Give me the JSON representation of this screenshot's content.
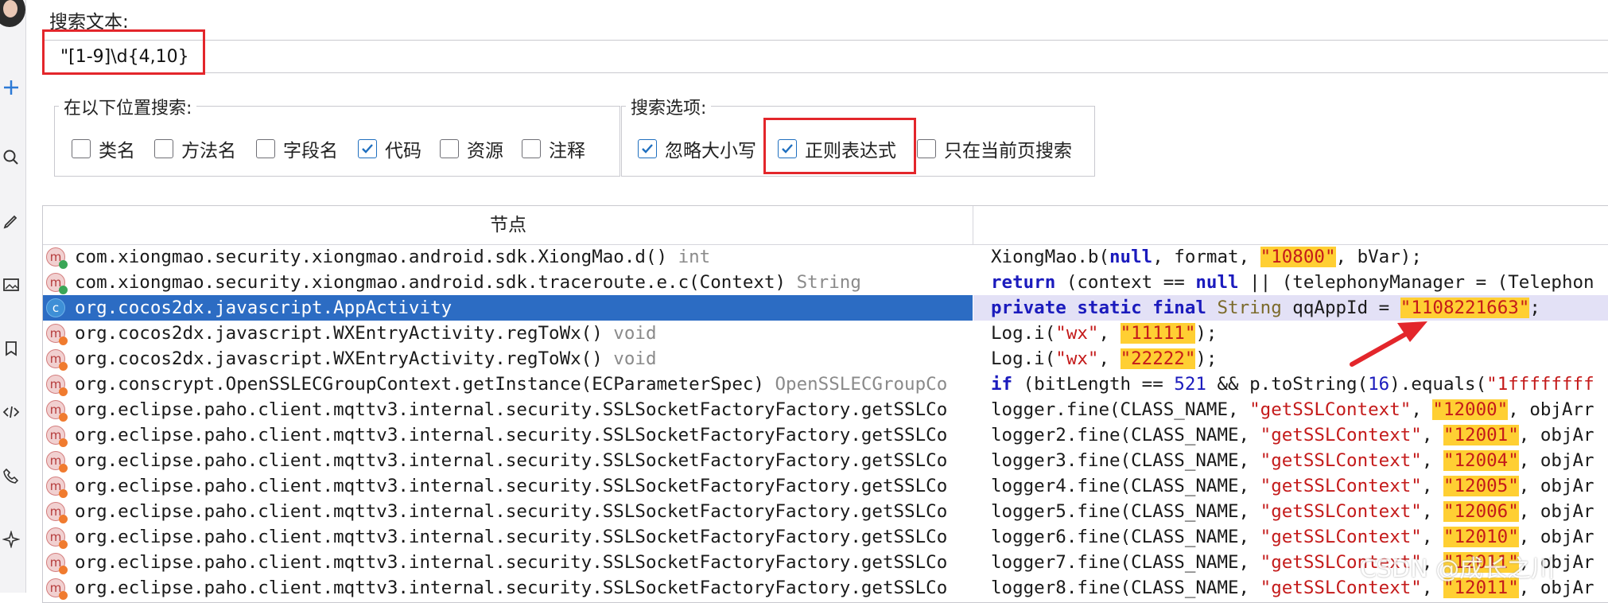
{
  "sidebar": {
    "icons": [
      "avatar",
      "plus-icon",
      "search-icon",
      "edit-icon",
      "image-icon",
      "bookmark-icon",
      "code-icon",
      "phone-icon",
      "sparkle-icon"
    ]
  },
  "search": {
    "label": "搜索文本:",
    "value": "\"[1-9]\\d{4,10}"
  },
  "location_group": {
    "title": "在以下位置搜索:",
    "options": [
      {
        "label": "类名",
        "checked": false
      },
      {
        "label": "方法名",
        "checked": false
      },
      {
        "label": "字段名",
        "checked": false
      },
      {
        "label": "代码",
        "checked": true
      },
      {
        "label": "资源",
        "checked": false
      },
      {
        "label": "注释",
        "checked": false
      }
    ]
  },
  "options_group": {
    "title": "搜索选项:",
    "options": [
      {
        "label": "忽略大小写",
        "checked": true
      },
      {
        "label": "正则表达式",
        "checked": true
      },
      {
        "label": "只在当前页搜索",
        "checked": false
      }
    ]
  },
  "results": {
    "header_node": "节点",
    "rows": [
      {
        "icon": "m",
        "node": "com.xiongmao.security.xiongmao.android.sdk.XiongMao.d()",
        "type": "int",
        "code": [
          [
            "XiongMao.b(",
            ""
          ],
          [
            "null",
            "kw"
          ],
          [
            ", format, ",
            ""
          ],
          [
            "\"10800\"",
            "hlstr"
          ],
          [
            ", bVar);",
            ""
          ]
        ]
      },
      {
        "icon": "m",
        "node": "com.xiongmao.security.xiongmao.android.sdk.traceroute.e.c(Context)",
        "type": "String",
        "code": [
          [
            "return",
            "kw"
          ],
          [
            " (context == ",
            ""
          ],
          [
            "null",
            "kw"
          ],
          [
            " || (telephonyManager = (Telephon",
            ""
          ]
        ]
      },
      {
        "icon": "c",
        "node": "org.cocos2dx.javascript.AppActivity",
        "type": "",
        "selected": true,
        "code": [
          [
            "private static final",
            "kw"
          ],
          [
            " ",
            ""
          ],
          [
            "String",
            "ty"
          ],
          [
            " qqAppId = ",
            ""
          ],
          [
            "\"1108221663\"",
            "hlstr"
          ],
          [
            ";",
            ""
          ]
        ]
      },
      {
        "icon": "m",
        "node": "org.cocos2dx.javascript.WXEntryActivity.regToWx()",
        "type": "void",
        "code": [
          [
            "Log.i(",
            ""
          ],
          [
            "\"wx\"",
            "str"
          ],
          [
            ", ",
            ""
          ],
          [
            "\"11111\"",
            "hlstr"
          ],
          [
            ");",
            ""
          ]
        ]
      },
      {
        "icon": "m",
        "node": "org.cocos2dx.javascript.WXEntryActivity.regToWx()",
        "type": "void",
        "code": [
          [
            "Log.i(",
            ""
          ],
          [
            "\"wx\"",
            "str"
          ],
          [
            ", ",
            ""
          ],
          [
            "\"22222\"",
            "hlstr"
          ],
          [
            ");",
            ""
          ]
        ]
      },
      {
        "icon": "m",
        "node": "org.conscrypt.OpenSSLECGroupContext.getInstance(ECParameterSpec)",
        "type": "OpenSSLECGroupCo",
        "code": [
          [
            "if",
            "kw"
          ],
          [
            " (bitLength == ",
            ""
          ],
          [
            "521",
            "num"
          ],
          [
            " && p.toString(",
            ""
          ],
          [
            "16",
            "num"
          ],
          [
            ").equals(",
            ""
          ],
          [
            "\"1ffffffff",
            "str"
          ]
        ]
      },
      {
        "icon": "m",
        "node": "org.eclipse.paho.client.mqttv3.internal.security.SSLSocketFactoryFactory.getSSLCo",
        "type": "",
        "code": [
          [
            "logger.fine(CLASS_NAME, ",
            ""
          ],
          [
            "\"getSSLContext\"",
            "str"
          ],
          [
            ", ",
            ""
          ],
          [
            "\"12000\"",
            "hlstr"
          ],
          [
            ", objArr",
            ""
          ]
        ]
      },
      {
        "icon": "m",
        "node": "org.eclipse.paho.client.mqttv3.internal.security.SSLSocketFactoryFactory.getSSLCo",
        "type": "",
        "code": [
          [
            "logger2.fine(CLASS_NAME, ",
            ""
          ],
          [
            "\"getSSLContext\"",
            "str"
          ],
          [
            ", ",
            ""
          ],
          [
            "\"12001\"",
            "hlstr"
          ],
          [
            ", objAr",
            ""
          ]
        ]
      },
      {
        "icon": "m",
        "node": "org.eclipse.paho.client.mqttv3.internal.security.SSLSocketFactoryFactory.getSSLCo",
        "type": "",
        "code": [
          [
            "logger3.fine(CLASS_NAME, ",
            ""
          ],
          [
            "\"getSSLContext\"",
            "str"
          ],
          [
            ", ",
            ""
          ],
          [
            "\"12004\"",
            "hlstr"
          ],
          [
            ", objAr",
            ""
          ]
        ]
      },
      {
        "icon": "m",
        "node": "org.eclipse.paho.client.mqttv3.internal.security.SSLSocketFactoryFactory.getSSLCo",
        "type": "",
        "code": [
          [
            "logger4.fine(CLASS_NAME, ",
            ""
          ],
          [
            "\"getSSLContext\"",
            "str"
          ],
          [
            ", ",
            ""
          ],
          [
            "\"12005\"",
            "hlstr"
          ],
          [
            ", objAr",
            ""
          ]
        ]
      },
      {
        "icon": "m",
        "node": "org.eclipse.paho.client.mqttv3.internal.security.SSLSocketFactoryFactory.getSSLCo",
        "type": "",
        "code": [
          [
            "logger5.fine(CLASS_NAME, ",
            ""
          ],
          [
            "\"getSSLContext\"",
            "str"
          ],
          [
            ", ",
            ""
          ],
          [
            "\"12006\"",
            "hlstr"
          ],
          [
            ", objAr",
            ""
          ]
        ]
      },
      {
        "icon": "m",
        "node": "org.eclipse.paho.client.mqttv3.internal.security.SSLSocketFactoryFactory.getSSLCo",
        "type": "",
        "code": [
          [
            "logger6.fine(CLASS_NAME, ",
            ""
          ],
          [
            "\"getSSLContext\"",
            "str"
          ],
          [
            ", ",
            ""
          ],
          [
            "\"12010\"",
            "hlstr"
          ],
          [
            ", objAr",
            ""
          ]
        ]
      },
      {
        "icon": "m",
        "node": "org.eclipse.paho.client.mqttv3.internal.security.SSLSocketFactoryFactory.getSSLCo",
        "type": "",
        "code": [
          [
            "logger7.fine(CLASS_NAME, ",
            ""
          ],
          [
            "\"getSSLContext\"",
            "str"
          ],
          [
            ", ",
            ""
          ],
          [
            "\"12011\"",
            "hlstr"
          ],
          [
            ", objAr",
            ""
          ]
        ]
      },
      {
        "icon": "m",
        "node": "org.eclipse.paho.client.mqttv3.internal.security.SSLSocketFactoryFactory.getSSLCo",
        "type": "",
        "code": [
          [
            "logger8.fine(CLASS_NAME, ",
            ""
          ],
          [
            "\"getSSLContext\"",
            "str"
          ],
          [
            ", ",
            ""
          ],
          [
            "\"12011\"",
            "hlstr"
          ],
          [
            ", objAr",
            ""
          ]
        ]
      }
    ]
  },
  "watermark": "CSDN @成长之川",
  "colors": {
    "accent": "#2c6cc3",
    "highlight": "#ffcf33",
    "annotation": "#e3262b"
  }
}
